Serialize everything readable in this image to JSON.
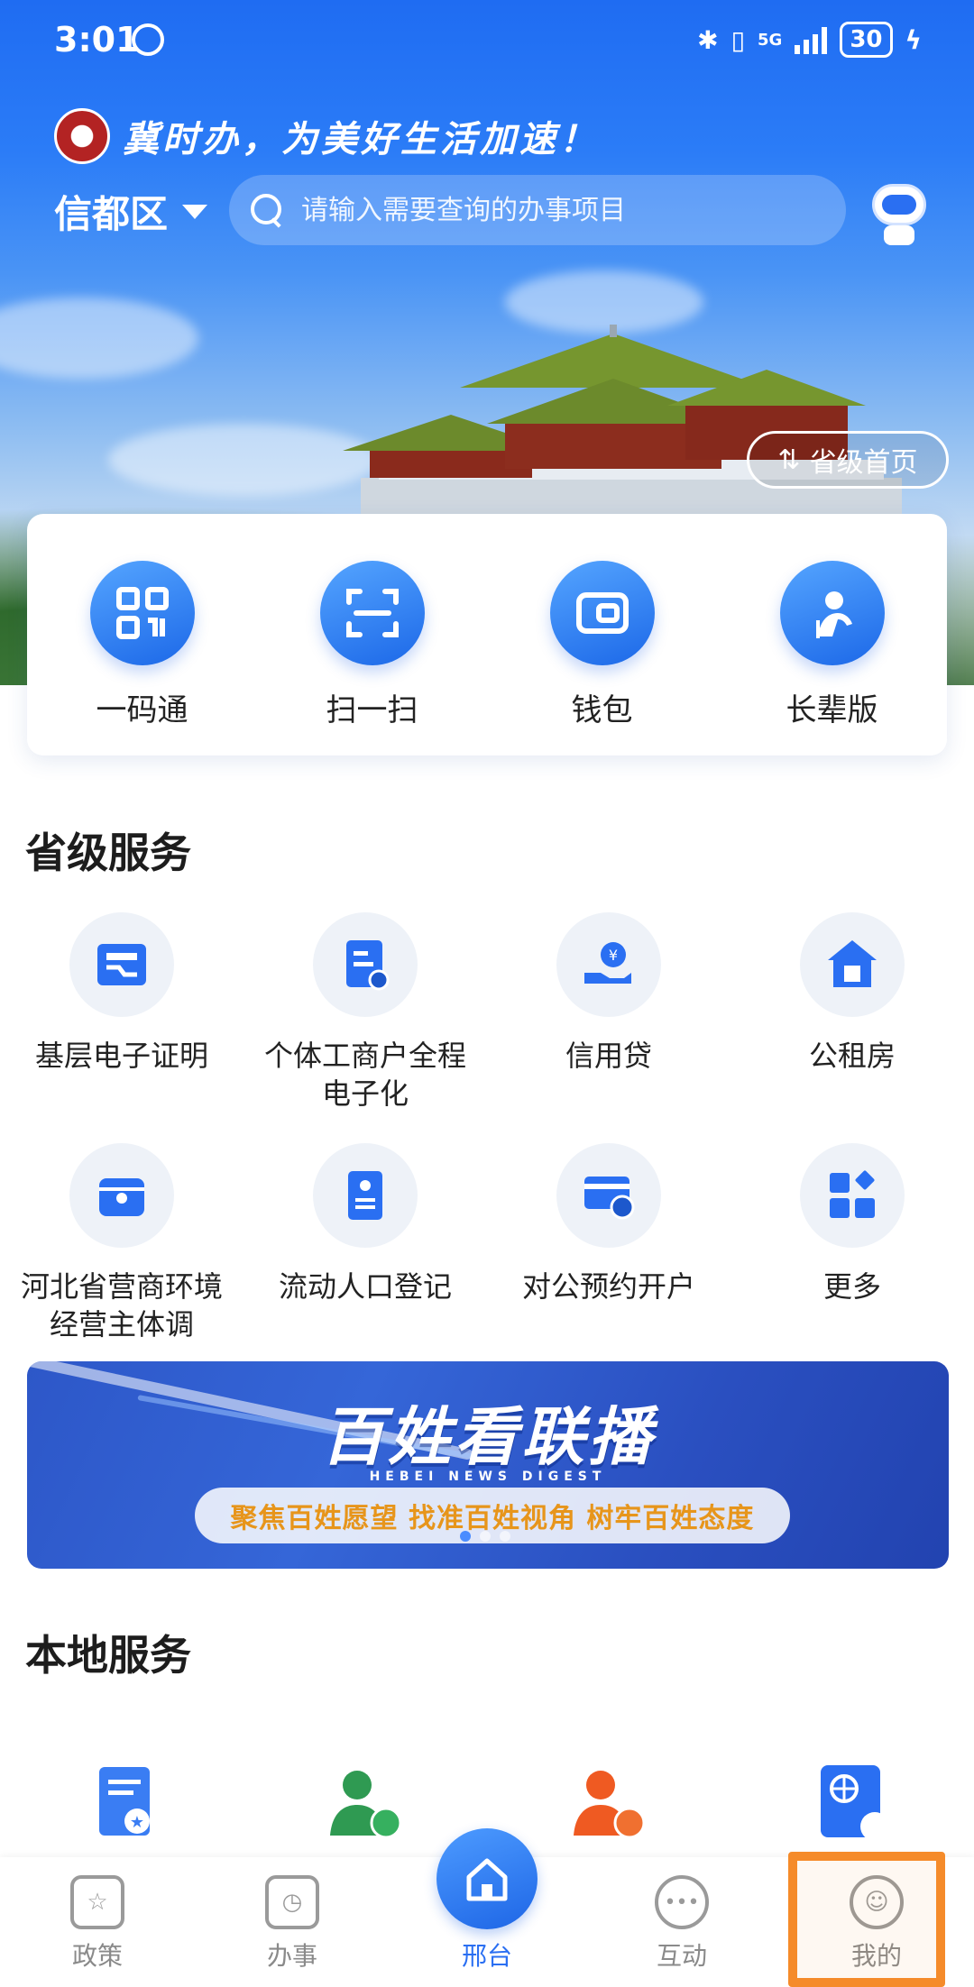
{
  "status_bar": {
    "time": "3:01",
    "network": "5G",
    "battery": "30"
  },
  "header": {
    "slogan": "冀时办，为美好生活加速！",
    "region": "信都区",
    "search_placeholder": "请输入需要查询的办事项目",
    "province_home": "省级首页"
  },
  "quick_actions": [
    {
      "label": "一码通",
      "icon": "qr-code-icon"
    },
    {
      "label": "扫一扫",
      "icon": "scan-icon"
    },
    {
      "label": "钱包",
      "icon": "wallet-icon"
    },
    {
      "label": "长辈版",
      "icon": "elder-mode-icon"
    }
  ],
  "provincial": {
    "title": "省级服务",
    "items": [
      {
        "label": "基层电子证明",
        "icon": "certificate-icon"
      },
      {
        "label": "个体工商户全程电子化",
        "icon": "business-doc-icon"
      },
      {
        "label": "信用贷",
        "icon": "credit-loan-icon"
      },
      {
        "label": "公租房",
        "icon": "rental-house-icon"
      },
      {
        "label": "河北省营商环境经营主体调",
        "icon": "shop-icon"
      },
      {
        "label": "流动人口登记",
        "icon": "registration-icon"
      },
      {
        "label": "对公预约开户",
        "icon": "account-card-icon"
      },
      {
        "label": "更多",
        "icon": "more-grid-icon"
      }
    ]
  },
  "banner": {
    "title": "百姓看联播",
    "subtitle": "HEBEI NEWS DIGEST",
    "tagline": "聚焦百姓愿望  找准百姓视角  树牢百姓态度"
  },
  "local": {
    "title": "本地服务"
  },
  "bottom_nav": [
    {
      "label": "政策",
      "icon": "policy-icon"
    },
    {
      "label": "办事",
      "icon": "affairs-icon"
    },
    {
      "label": "邢台",
      "icon": "home-icon"
    },
    {
      "label": "互动",
      "icon": "chat-icon"
    },
    {
      "label": "我的",
      "icon": "profile-icon"
    }
  ],
  "colors": {
    "brand_blue": "#2a6ff2",
    "highlight_orange": "#f58b2a"
  }
}
